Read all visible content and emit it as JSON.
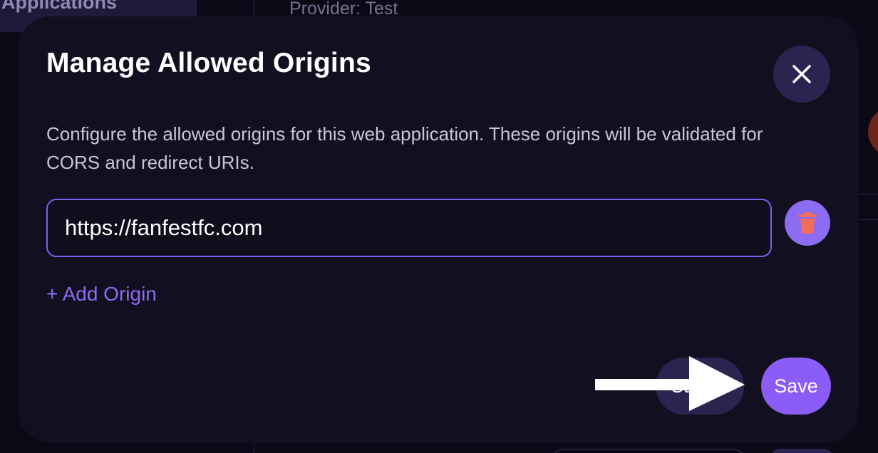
{
  "background": {
    "nav_active_label": "Applications",
    "provider_text": "Provider: Test"
  },
  "modal": {
    "title": "Manage Allowed Origins",
    "close_icon": "close-icon",
    "description": "Configure the allowed origins for this web application. These origins will be validated for CORS and redirect URIs.",
    "origins": [
      {
        "value": "https://fanfestfc.com"
      }
    ],
    "delete_icon": "trash-icon",
    "add_origin_label": "+ Add Origin",
    "cancel_label": "Cancel",
    "save_label": "Save"
  },
  "overlay": {
    "pointer_icon": "arrow-right-icon"
  },
  "colors": {
    "accent": "#8b5cf6",
    "modal_bg": "#120f20",
    "page_bg": "#0b0916",
    "secondary_button": "#2a2550"
  }
}
